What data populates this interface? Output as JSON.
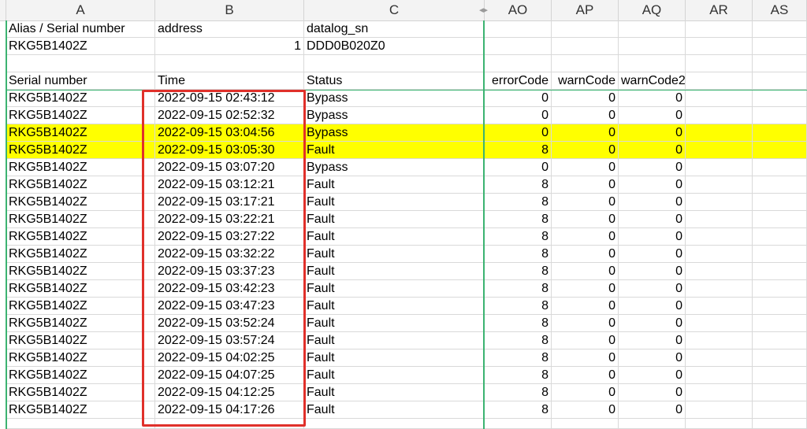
{
  "columns": [
    {
      "letter": "A"
    },
    {
      "letter": "B"
    },
    {
      "letter": "C"
    },
    {
      "letter": "AO"
    },
    {
      "letter": "AP"
    },
    {
      "letter": "AQ"
    },
    {
      "letter": "AR"
    },
    {
      "letter": "AS"
    }
  ],
  "split_icon": "split-handle-icon",
  "rows": [
    [
      "Alias / Serial number",
      "address",
      "datalog_sn",
      "",
      "",
      "",
      "",
      ""
    ],
    [
      "RKG5B1402Z",
      "1",
      "DDD0B020Z0",
      "",
      "",
      "",
      "",
      ""
    ],
    [
      "",
      "",
      "",
      "",
      "",
      "",
      "",
      ""
    ],
    [
      "Serial number",
      "Time",
      "Status",
      "errorCode",
      "warnCode",
      "warnCode2",
      "",
      ""
    ],
    [
      "RKG5B1402Z",
      "2022-09-15 02:43:12",
      "Bypass",
      "0",
      "0",
      "0",
      "",
      ""
    ],
    [
      "RKG5B1402Z",
      "2022-09-15 02:52:32",
      "Bypass",
      "0",
      "0",
      "0",
      "",
      ""
    ],
    [
      "RKG5B1402Z",
      "2022-09-15 03:04:56",
      "Bypass",
      "0",
      "0",
      "0",
      "",
      ""
    ],
    [
      "RKG5B1402Z",
      "2022-09-15 03:05:30",
      "Fault",
      "8",
      "0",
      "0",
      "",
      ""
    ],
    [
      "RKG5B1402Z",
      "2022-09-15 03:07:20",
      "Bypass",
      "0",
      "0",
      "0",
      "",
      ""
    ],
    [
      "RKG5B1402Z",
      "2022-09-15 03:12:21",
      "Fault",
      "8",
      "0",
      "0",
      "",
      ""
    ],
    [
      "RKG5B1402Z",
      "2022-09-15 03:17:21",
      "Fault",
      "8",
      "0",
      "0",
      "",
      ""
    ],
    [
      "RKG5B1402Z",
      "2022-09-15 03:22:21",
      "Fault",
      "8",
      "0",
      "0",
      "",
      ""
    ],
    [
      "RKG5B1402Z",
      "2022-09-15 03:27:22",
      "Fault",
      "8",
      "0",
      "0",
      "",
      ""
    ],
    [
      "RKG5B1402Z",
      "2022-09-15 03:32:22",
      "Fault",
      "8",
      "0",
      "0",
      "",
      ""
    ],
    [
      "RKG5B1402Z",
      "2022-09-15 03:37:23",
      "Fault",
      "8",
      "0",
      "0",
      "",
      ""
    ],
    [
      "RKG5B1402Z",
      "2022-09-15 03:42:23",
      "Fault",
      "8",
      "0",
      "0",
      "",
      ""
    ],
    [
      "RKG5B1402Z",
      "2022-09-15 03:47:23",
      "Fault",
      "8",
      "0",
      "0",
      "",
      ""
    ],
    [
      "RKG5B1402Z",
      "2022-09-15 03:52:24",
      "Fault",
      "8",
      "0",
      "0",
      "",
      ""
    ],
    [
      "RKG5B1402Z",
      "2022-09-15 03:57:24",
      "Fault",
      "8",
      "0",
      "0",
      "",
      ""
    ],
    [
      "RKG5B1402Z",
      "2022-09-15 04:02:25",
      "Fault",
      "8",
      "0",
      "0",
      "",
      ""
    ],
    [
      "RKG5B1402Z",
      "2022-09-15 04:07:25",
      "Fault",
      "8",
      "0",
      "0",
      "",
      ""
    ],
    [
      "RKG5B1402Z",
      "2022-09-15 04:12:25",
      "Fault",
      "8",
      "0",
      "0",
      "",
      ""
    ],
    [
      "RKG5B1402Z",
      "2022-09-15 04:17:26",
      "Fault",
      "8",
      "0",
      "0",
      "",
      ""
    ]
  ],
  "highlighted_rows": [
    6,
    7
  ],
  "highlight_color": "#ffff00",
  "annotation_color": "#e0302a",
  "freeze_line_color": "#3cb371"
}
